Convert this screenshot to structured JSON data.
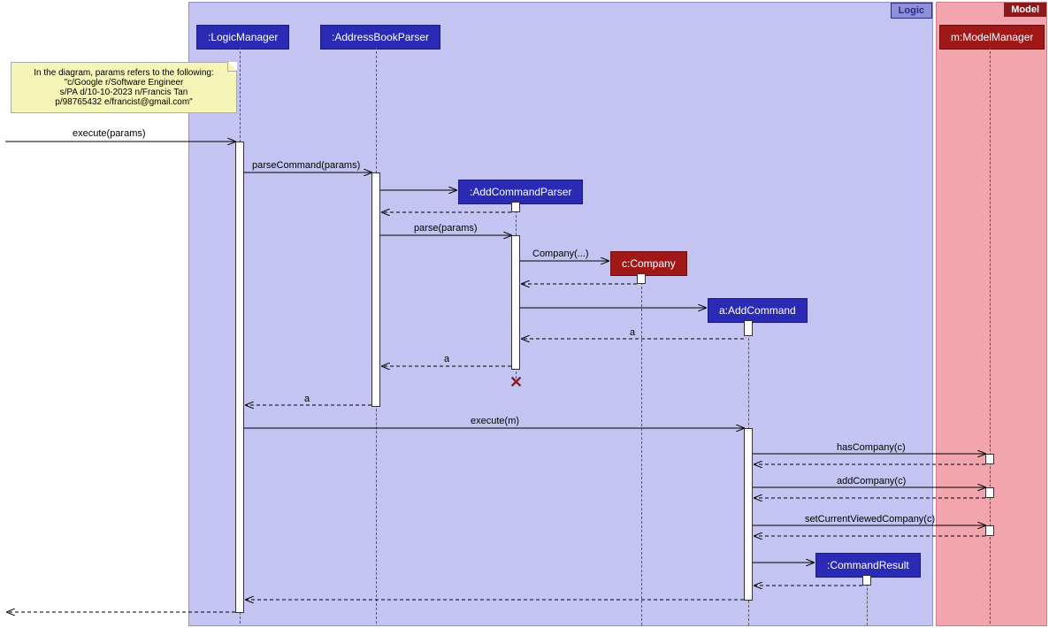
{
  "regions": {
    "logic": {
      "label": "Logic"
    },
    "model": {
      "label": "Model"
    }
  },
  "participants": {
    "logicManager": ":LogicManager",
    "addressBookParser": ":AddressBookParser",
    "addCommandParser": ":AddCommandParser",
    "company": "c:Company",
    "addCommand": "a:AddCommand",
    "modelManager": "m:ModelManager",
    "commandResult": ":CommandResult"
  },
  "note": {
    "line1": "In the diagram, params refers to the following:",
    "line2": "\"c/Google r/Software Engineer",
    "line3": "s/PA d/10-10-2023 n/Francis Tan",
    "line4": "p/98765432 e/francist@gmail.com\""
  },
  "messages": {
    "executeParams": "execute(params)",
    "parseCommandParams": "parseCommand(params)",
    "parseParams": "parse(params)",
    "companyCtor": "Company(...)",
    "a1": "a",
    "a2": "a",
    "a3": "a",
    "executeM": "execute(m)",
    "hasCompany": "hasCompany(c)",
    "addCompany": "addCompany(c)",
    "setCurrentViewed": "setCurrentViewedCompany(c)"
  }
}
